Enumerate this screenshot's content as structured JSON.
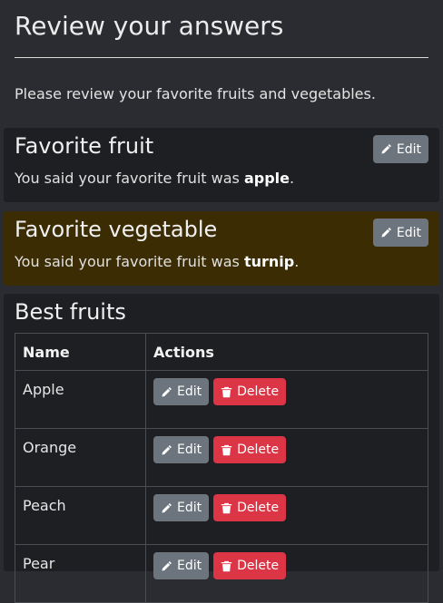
{
  "page": {
    "title": "Review your answers",
    "intro": "Please review your favorite fruits and vegetables."
  },
  "favorite_fruit": {
    "title": "Favorite fruit",
    "text_prefix": "You said your favorite fruit was ",
    "value": "apple",
    "text_suffix": ".",
    "edit_label": "Edit"
  },
  "favorite_vegetable": {
    "title": "Favorite vegetable",
    "text_prefix": "You said your favorite fruit was ",
    "value": "turnip",
    "text_suffix": ".",
    "edit_label": "Edit"
  },
  "best_fruits": {
    "title": "Best fruits",
    "columns": [
      "Name",
      "Actions"
    ],
    "rows": [
      {
        "name": "Apple",
        "edit_label": "Edit",
        "delete_label": "Delete"
      },
      {
        "name": "Orange",
        "edit_label": "Edit",
        "delete_label": "Delete"
      },
      {
        "name": "Peach",
        "edit_label": "Edit",
        "delete_label": "Delete"
      },
      {
        "name": "Pear",
        "edit_label": "Edit",
        "delete_label": "Delete"
      }
    ]
  },
  "icons": {
    "edit": "pencil-icon",
    "delete": "trash-icon"
  },
  "colors": {
    "background": "#2a2c31",
    "card": "#1d1f22",
    "warning_card": "#3b2c03",
    "secondary_button": "#6c757d",
    "danger_button": "#dc3545"
  }
}
